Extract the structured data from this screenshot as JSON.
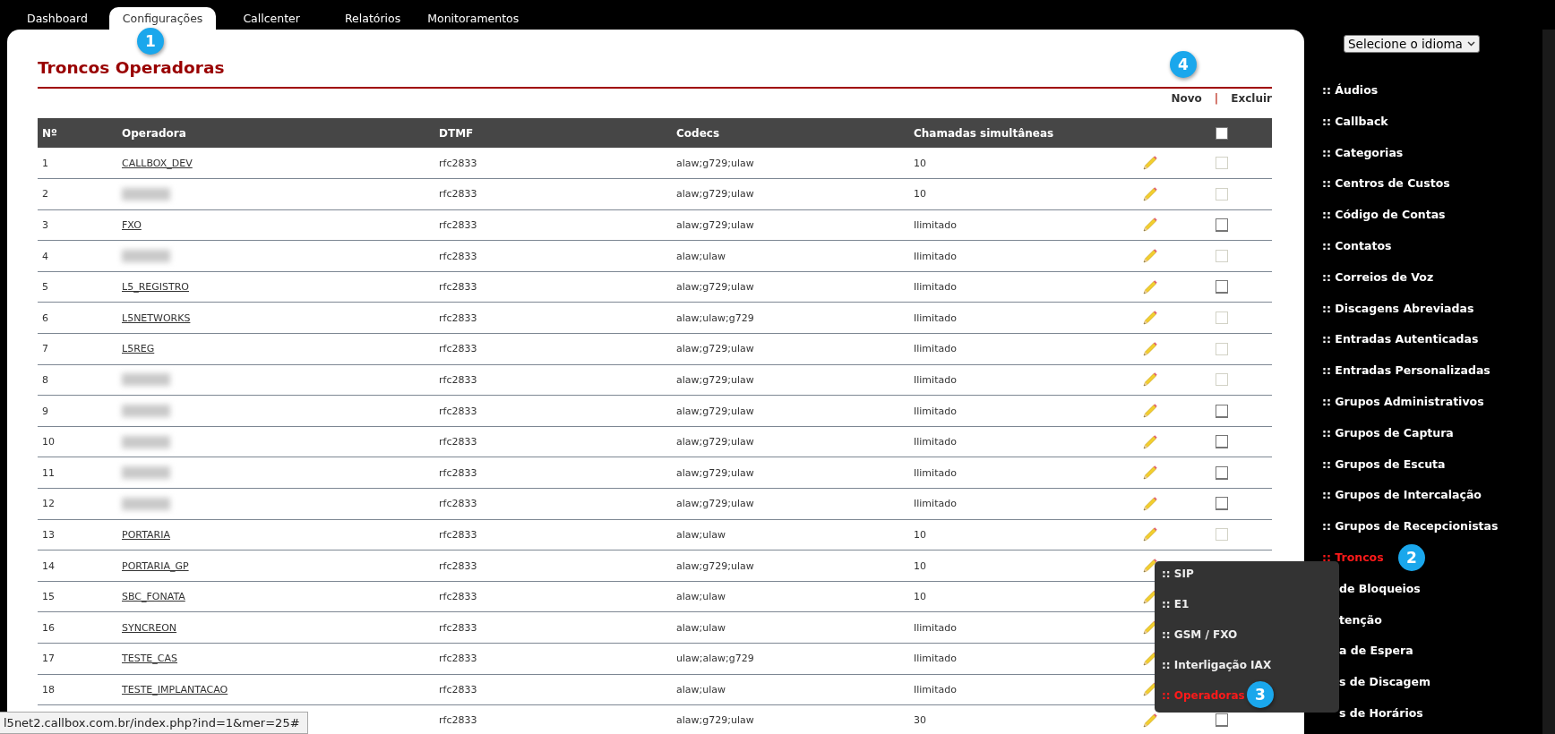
{
  "tabs": [
    {
      "label": "Dashboard",
      "selected": false
    },
    {
      "label": "Configurações",
      "selected": true,
      "badge": "1"
    },
    {
      "label": "Callcenter",
      "selected": false
    },
    {
      "label": "Relatórios",
      "selected": false
    },
    {
      "label": "Monitoramentos",
      "selected": false
    }
  ],
  "page": {
    "title": "Troncos Operadoras",
    "actions": [
      "Novo",
      "Excluir"
    ],
    "separator": "|",
    "actions_badge": "4"
  },
  "table": {
    "columns": [
      "Nº",
      "Operadora",
      "DTMF",
      "Codecs",
      "Chamadas simultâneas"
    ],
    "select_all": {
      "checked": false
    },
    "rows": [
      {
        "n": "1",
        "operadora": "CALLBOX_DEV",
        "dtmf": "rfc2833",
        "codecs": "alaw;g729;ulaw",
        "chamadas": "10",
        "checkbox": {
          "checked": false,
          "disabled": true
        }
      },
      {
        "n": "2",
        "redacted": true,
        "dtmf": "rfc2833",
        "codecs": "alaw;g729;ulaw",
        "chamadas": "10",
        "checkbox": {
          "checked": false,
          "disabled": true
        }
      },
      {
        "n": "3",
        "operadora": "FXO",
        "dtmf": "rfc2833",
        "codecs": "alaw;g729;ulaw",
        "chamadas": "Ilimitado",
        "checkbox": {
          "checked": false,
          "disabled": false
        }
      },
      {
        "n": "4",
        "redacted": true,
        "dtmf": "rfc2833",
        "codecs": "alaw;ulaw",
        "chamadas": "Ilimitado",
        "checkbox": {
          "checked": false,
          "disabled": true
        }
      },
      {
        "n": "5",
        "operadora": "L5_REGISTRO",
        "dtmf": "rfc2833",
        "codecs": "alaw;g729;ulaw",
        "chamadas": "Ilimitado",
        "checkbox": {
          "checked": false,
          "disabled": false
        }
      },
      {
        "n": "6",
        "operadora": "L5NETWORKS",
        "dtmf": "rfc2833",
        "codecs": "alaw;ulaw;g729",
        "chamadas": "Ilimitado",
        "checkbox": {
          "checked": false,
          "disabled": true
        }
      },
      {
        "n": "7",
        "operadora": "L5REG",
        "dtmf": "rfc2833",
        "codecs": "alaw;g729;ulaw",
        "chamadas": "Ilimitado",
        "checkbox": {
          "checked": false,
          "disabled": true
        }
      },
      {
        "n": "8",
        "redacted": true,
        "dtmf": "rfc2833",
        "codecs": "alaw;g729;ulaw",
        "chamadas": "Ilimitado",
        "checkbox": {
          "checked": false,
          "disabled": true
        }
      },
      {
        "n": "9",
        "redacted": true,
        "dtmf": "rfc2833",
        "codecs": "alaw;g729;ulaw",
        "chamadas": "Ilimitado",
        "checkbox": {
          "checked": false,
          "disabled": false
        }
      },
      {
        "n": "10",
        "redacted": true,
        "dtmf": "rfc2833",
        "codecs": "alaw;g729;ulaw",
        "chamadas": "Ilimitado",
        "checkbox": {
          "checked": false,
          "disabled": false
        }
      },
      {
        "n": "11",
        "redacted": true,
        "dtmf": "rfc2833",
        "codecs": "alaw;g729;ulaw",
        "chamadas": "Ilimitado",
        "checkbox": {
          "checked": false,
          "disabled": false
        }
      },
      {
        "n": "12",
        "redacted": true,
        "dtmf": "rfc2833",
        "codecs": "alaw;g729;ulaw",
        "chamadas": "Ilimitado",
        "checkbox": {
          "checked": false,
          "disabled": false
        }
      },
      {
        "n": "13",
        "operadora": "PORTARIA",
        "dtmf": "rfc2833",
        "codecs": "alaw;ulaw",
        "chamadas": "10",
        "checkbox": {
          "checked": false,
          "disabled": true
        }
      },
      {
        "n": "14",
        "operadora": "PORTARIA_GP",
        "dtmf": "rfc2833",
        "codecs": "alaw;g729;ulaw",
        "chamadas": "10"
      },
      {
        "n": "15",
        "operadora": "SBC_FONATA",
        "dtmf": "rfc2833",
        "codecs": "alaw;ulaw",
        "chamadas": "10"
      },
      {
        "n": "16",
        "operadora": "SYNCREON",
        "dtmf": "rfc2833",
        "codecs": "alaw;ulaw",
        "chamadas": "Ilimitado"
      },
      {
        "n": "17",
        "operadora": "TESTE_CAS",
        "dtmf": "rfc2833",
        "codecs": "ulaw;alaw;g729",
        "chamadas": "Ilimitado"
      },
      {
        "n": "18",
        "operadora": "TESTE_IMPLANTACAO",
        "dtmf": "rfc2833",
        "codecs": "alaw;ulaw",
        "chamadas": "Ilimitado"
      },
      {
        "dtmf": "rfc2833",
        "codecs": "alaw;g729;ulaw",
        "chamadas": "30",
        "checkbox": {
          "checked": false,
          "disabled": false
        }
      }
    ]
  },
  "language_select": {
    "value": "Selecione o idioma"
  },
  "sidebar": {
    "items": [
      {
        "label": ":: Áudios",
        "selected": false
      },
      {
        "label": ":: Callback",
        "selected": false
      },
      {
        "label": ":: Categorias",
        "selected": false
      },
      {
        "label": ":: Centros de Custos",
        "selected": false
      },
      {
        "label": ":: Código de Contas",
        "selected": false
      },
      {
        "label": ":: Contatos",
        "selected": false
      },
      {
        "label": ":: Correios de Voz",
        "selected": false
      },
      {
        "label": ":: Discagens Abreviadas",
        "selected": false
      },
      {
        "label": ":: Entradas Autenticadas",
        "selected": false
      },
      {
        "label": ":: Entradas Personalizadas",
        "selected": false
      },
      {
        "label": ":: Grupos Administrativos",
        "selected": false
      },
      {
        "label": ":: Grupos de Captura",
        "selected": false
      },
      {
        "label": ":: Grupos de Escuta",
        "selected": false
      },
      {
        "label": ":: Grupos de Intercalação",
        "selected": false
      },
      {
        "label": ":: Grupos de Recepcionistas",
        "selected": false
      },
      {
        "label": ":: Troncos",
        "selected": true,
        "badge": "2"
      },
      {
        "label": "de Bloqueios",
        "selected": false,
        "kind": "partial"
      },
      {
        "label": "tenção",
        "selected": false,
        "kind": "partial"
      },
      {
        "label": "a de Espera",
        "selected": false,
        "kind": "partial"
      },
      {
        "label": "s de Discagem",
        "selected": false,
        "kind": "partial"
      },
      {
        "label": "s de Horários",
        "selected": false,
        "kind": "partial"
      }
    ]
  },
  "submenu": {
    "items": [
      {
        "label": ":: SIP",
        "selected": false
      },
      {
        "label": ":: E1",
        "selected": false
      },
      {
        "label": ":: GSM / FXO",
        "selected": false
      },
      {
        "label": ":: Interligação IAX",
        "selected": false
      },
      {
        "label": ":: Operadoras",
        "selected": true,
        "badge": "3"
      }
    ]
  },
  "status_url": "l5net2.callbox.com.br/index.php?ind=1&mer=25#"
}
